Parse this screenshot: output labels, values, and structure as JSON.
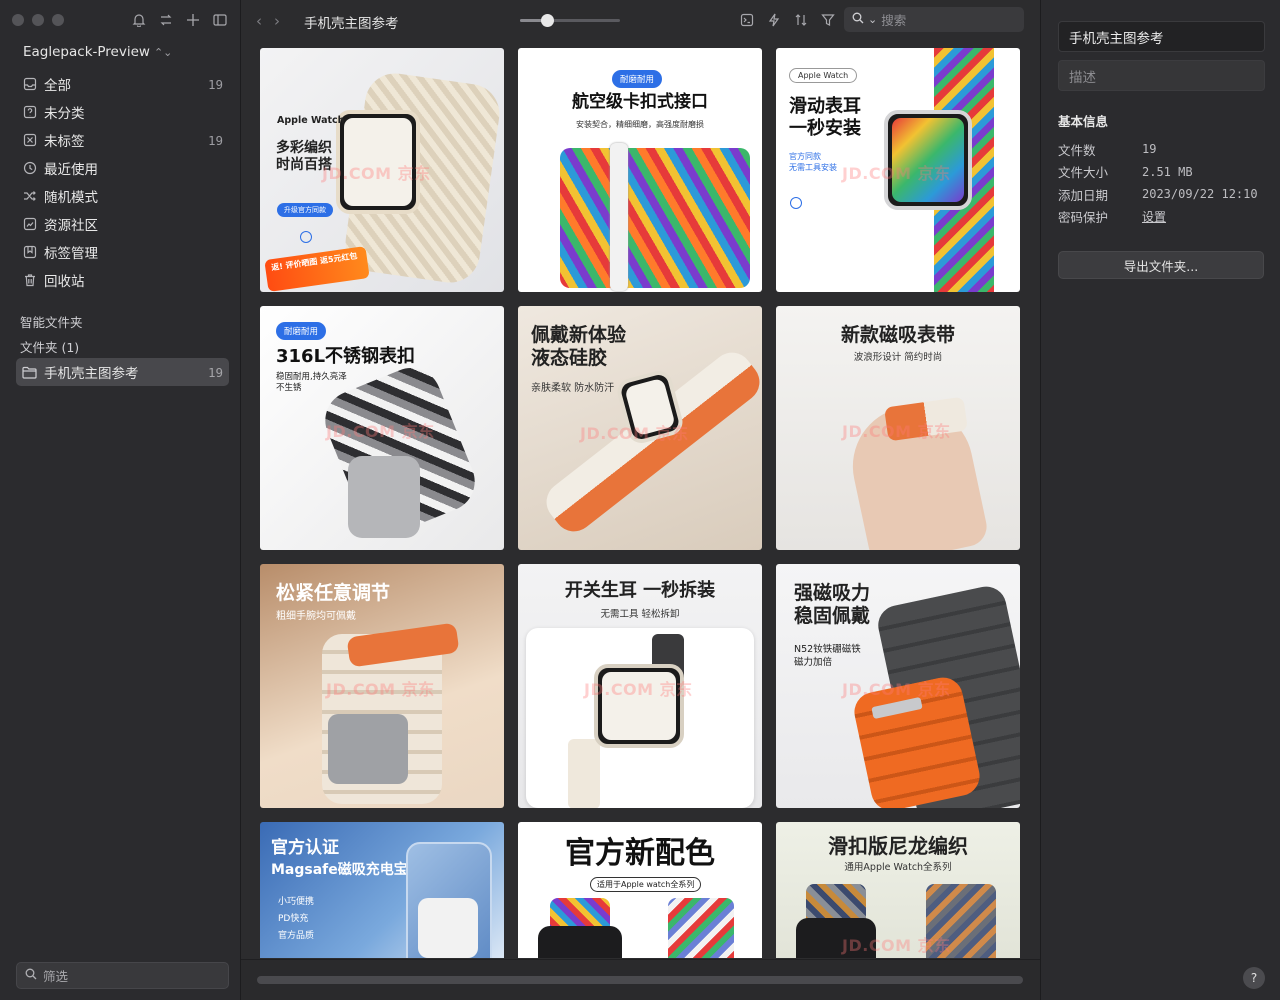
{
  "sidebar": {
    "library_name": "Eaglepack-Preview",
    "nav": [
      {
        "label": "全部",
        "count": "19",
        "icon": "inbox-icon"
      },
      {
        "label": "未分类",
        "count": "",
        "icon": "question-square-icon"
      },
      {
        "label": "未标签",
        "count": "19",
        "icon": "untagged-icon"
      },
      {
        "label": "最近使用",
        "count": "",
        "icon": "clock-icon"
      },
      {
        "label": "随机模式",
        "count": "",
        "icon": "shuffle-icon"
      },
      {
        "label": "资源社区",
        "count": "",
        "icon": "community-icon"
      },
      {
        "label": "标签管理",
        "count": "",
        "icon": "bookmark-icon"
      },
      {
        "label": "回收站",
        "count": "",
        "icon": "trash-icon"
      }
    ],
    "smart_folders_title": "智能文件夹",
    "folders_title": "文件夹 (1)",
    "folder": {
      "label": "手机壳主图参考",
      "count": "19"
    },
    "filter_placeholder": "筛选"
  },
  "main": {
    "breadcrumb": "手机壳主图参考",
    "zoom_fraction": 0.26,
    "search_placeholder": "搜索",
    "watermark": "JD.COM 京东",
    "cards": [
      {
        "headline": "多彩编织\n时尚百搭",
        "top_label": "Apple Watch",
        "sub": "升级官方同款",
        "corner": "返! 评价晒图 返5元红包"
      },
      {
        "badge": "耐磨耐用",
        "headline": "航空级卡扣式接口",
        "sub": "安装契合，精细细磨，高强度耐磨损"
      },
      {
        "badge": "Apple Watch",
        "headline": "滑动表耳\n一秒安装",
        "sub": "官方同款\n无需工具安装"
      },
      {
        "badge": "耐磨耐用",
        "headline": "316L不锈钢表扣",
        "sub": "稳固耐用,持久亮泽\n不生锈"
      },
      {
        "headline": "佩戴新体验\n液态硅胶",
        "sub": "亲肤柔软 防水防汗"
      },
      {
        "headline": "新款磁吸表带",
        "sub": "波浪形设计 简约时尚"
      },
      {
        "headline": "松紧任意调节",
        "sub": "粗细手腕均可佩戴"
      },
      {
        "headline": "开关生耳 一秒拆装",
        "sub": "无需工具 轻松拆卸"
      },
      {
        "headline": "强磁吸力\n稳固佩戴",
        "sub": "N52钕铁硼磁铁\n磁力加倍"
      },
      {
        "headline": "官方认证",
        "sub": "Magsafe磁吸充电宝",
        "list": [
          "小巧便携",
          "PD快充",
          "官方品质"
        ]
      },
      {
        "headline": "官方新配色",
        "sub": "适用于Apple watch全系列"
      },
      {
        "headline": "滑扣版尼龙编织",
        "sub": "通用Apple Watch全系列"
      }
    ]
  },
  "inspector": {
    "title": "手机壳主图参考",
    "description_placeholder": "描述",
    "section": "基本信息",
    "rows": [
      {
        "key": "文件数",
        "value": "19"
      },
      {
        "key": "文件大小",
        "value": "2.51 MB"
      },
      {
        "key": "添加日期",
        "value": "2023/09/22 12:10"
      },
      {
        "key": "密码保护",
        "value": "设置"
      }
    ],
    "export_label": "导出文件夹...",
    "help_label": "?"
  },
  "colors": {
    "badge_blue": "#2d6fe6",
    "strap_orange": "#e8743a",
    "background": "#2c2c2e"
  }
}
